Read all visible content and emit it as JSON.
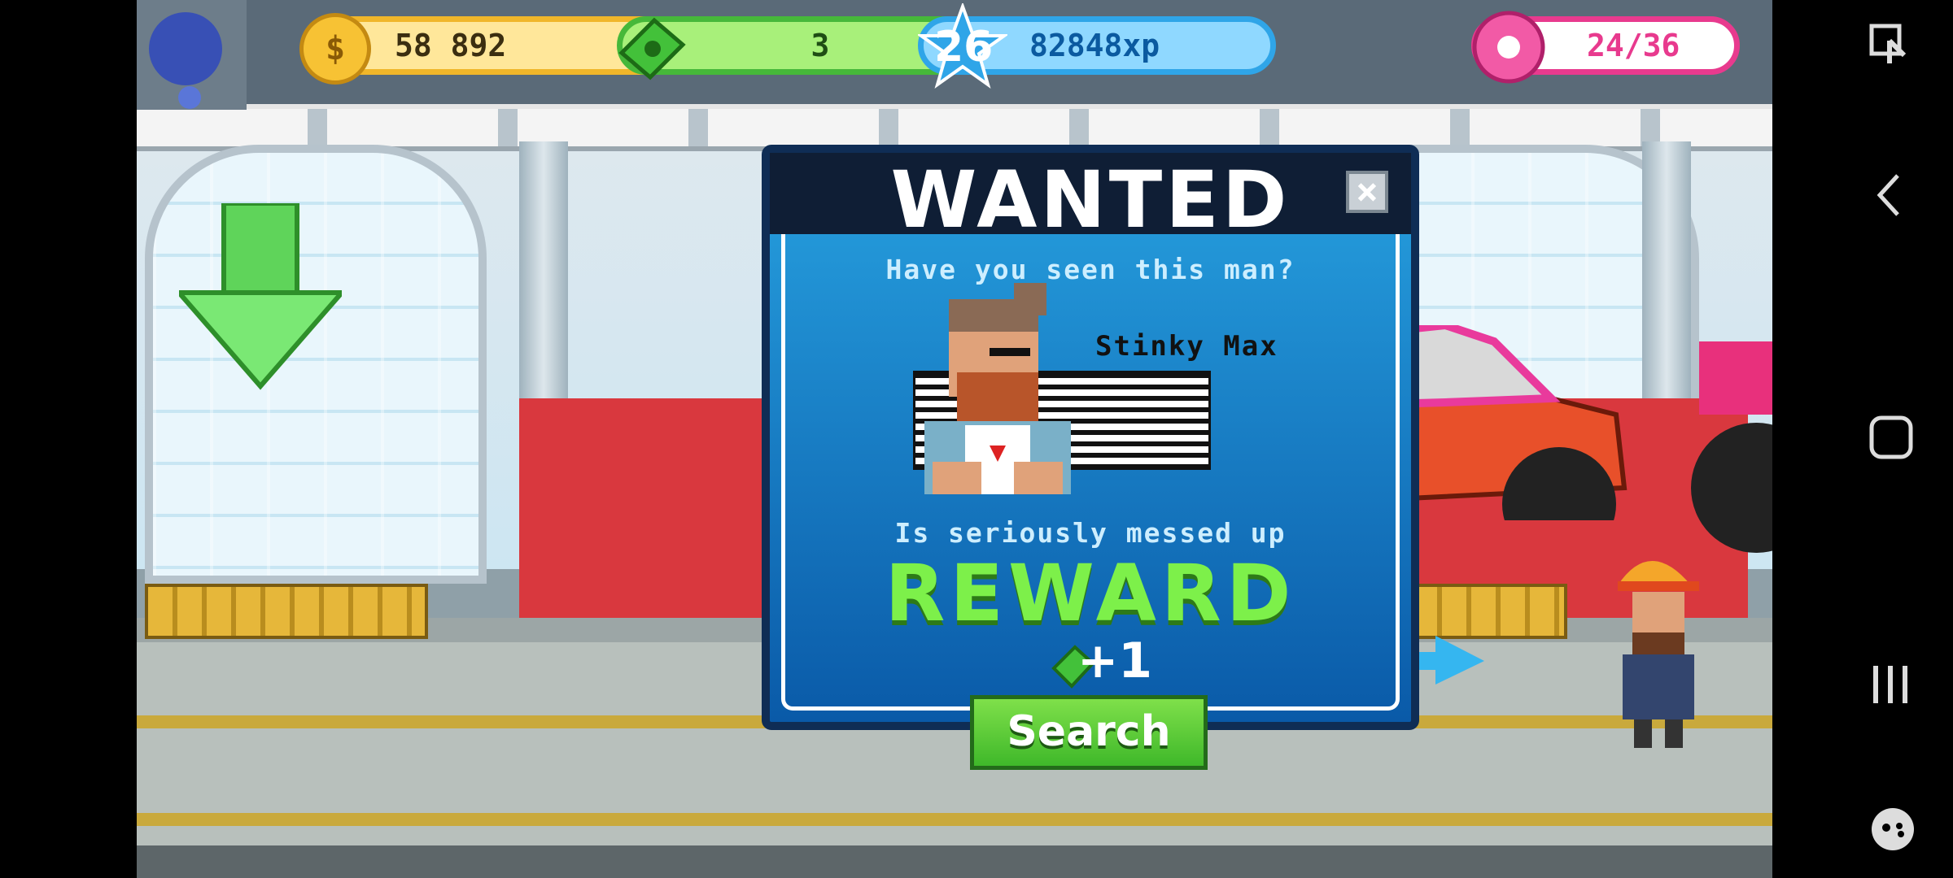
{
  "hud": {
    "coins": "58 892",
    "cash": "3",
    "level": "26",
    "xp": "82848xp",
    "donuts": "24/36",
    "plus": "+"
  },
  "dialog": {
    "title": "WANTED",
    "close": "×",
    "subtitle": "Have you seen this man?",
    "suspect_name": "Stinky Max",
    "description": "Is seriously messed up",
    "reward_label": "REWARD",
    "reward_amount": "+1",
    "search_button": "Search"
  },
  "colors": {
    "dialog_blue": "#1a86d0",
    "reward_green": "#7df04a",
    "button_green": "#5cc83a",
    "donut_pink": "#e83a8e"
  },
  "icons": {
    "coin": "coin-icon",
    "cash": "cash-icon",
    "xp": "star-level-icon",
    "donut": "donut-icon",
    "arrow": "green-down-arrow-icon"
  }
}
